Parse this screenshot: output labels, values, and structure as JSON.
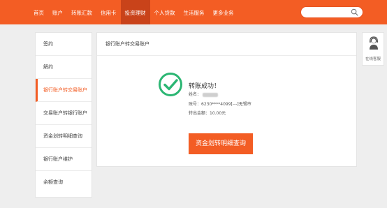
{
  "nav": {
    "items": [
      "首页",
      "账户",
      "转账汇款",
      "信用卡",
      "投资理财",
      "个人贷款",
      "生活服务",
      "更多业务"
    ],
    "active_index": 4
  },
  "search": {
    "placeholder": "",
    "icon": "search-icon"
  },
  "sidebar": {
    "items": [
      "签约",
      "解约",
      "银行账户转交易账户",
      "交易账户转银行账户",
      "资金划转明细查询",
      "银行账户维护",
      "余额查询"
    ],
    "active_index": 2
  },
  "panel": {
    "title": "银行账户转交易账户",
    "success_title": "转账成功！",
    "name_label": "姓名：",
    "account_line": "账号：6230****4099[---]无锡市",
    "amount_line": "转出金额：10.00元",
    "query_button": "资金划转明细查询"
  },
  "service": {
    "label": "在线客服",
    "icon": "headset-agent-icon"
  },
  "colors": {
    "brand": "#f35d24",
    "nav_active": "#c9431a",
    "success": "#2bb673"
  }
}
